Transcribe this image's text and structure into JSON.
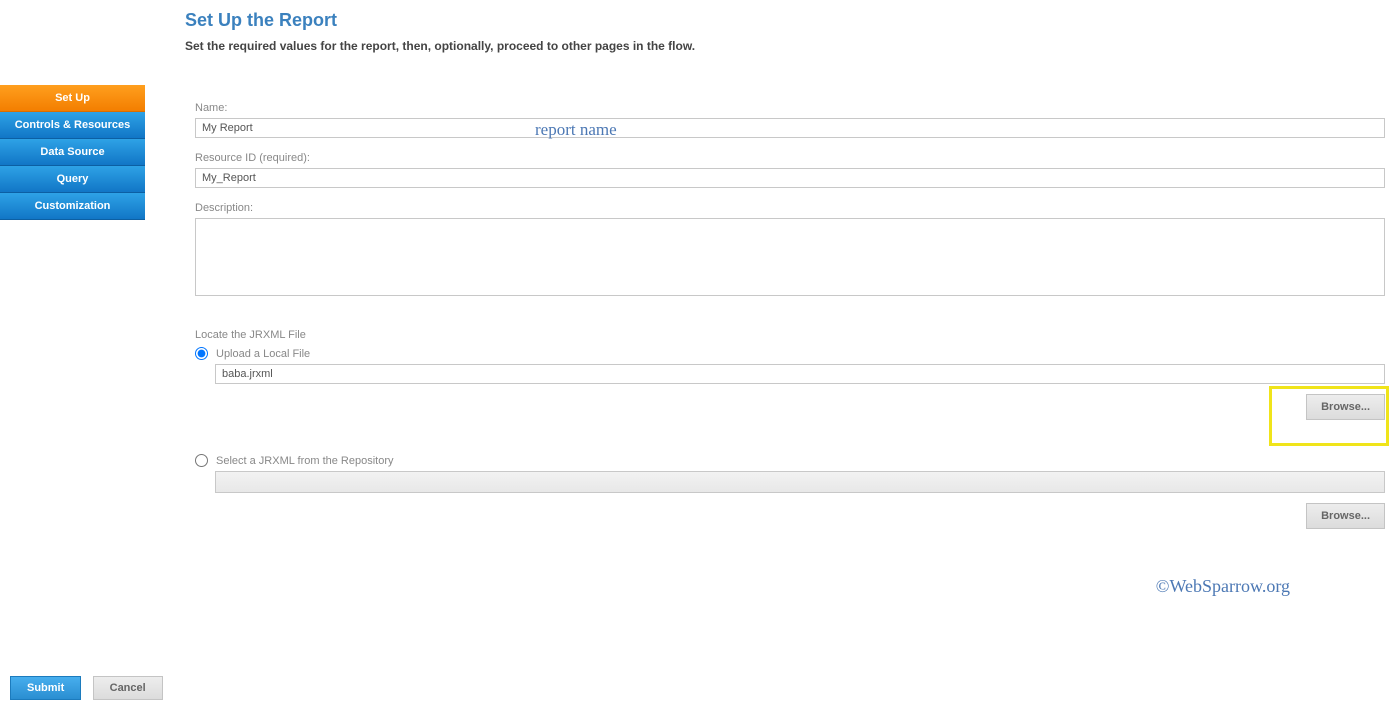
{
  "header": {
    "title": "Set Up the Report",
    "subtitle": "Set the required values for the report, then, optionally, proceed to other pages in the flow."
  },
  "sidebar": {
    "items": [
      {
        "label": "Set Up",
        "active": true
      },
      {
        "label": "Controls & Resources",
        "active": false
      },
      {
        "label": "Data Source",
        "active": false
      },
      {
        "label": "Query",
        "active": false
      },
      {
        "label": "Customization",
        "active": false
      }
    ]
  },
  "form": {
    "name_label": "Name:",
    "name_value": "My Report",
    "name_annot": "report name",
    "resid_label": "Resource ID (required):",
    "resid_value": "My_Report",
    "desc_label": "Description:",
    "desc_value": "",
    "locate_label": "Locate the JRXML File",
    "upload_label": "Upload a Local File",
    "upload_value": "baba.jrxml",
    "repo_label": "Select a JRXML from the Repository",
    "repo_value": "",
    "browse_label": "Browse..."
  },
  "watermark": "©WebSparrow.org",
  "footer": {
    "submit": "Submit",
    "cancel": "Cancel"
  }
}
